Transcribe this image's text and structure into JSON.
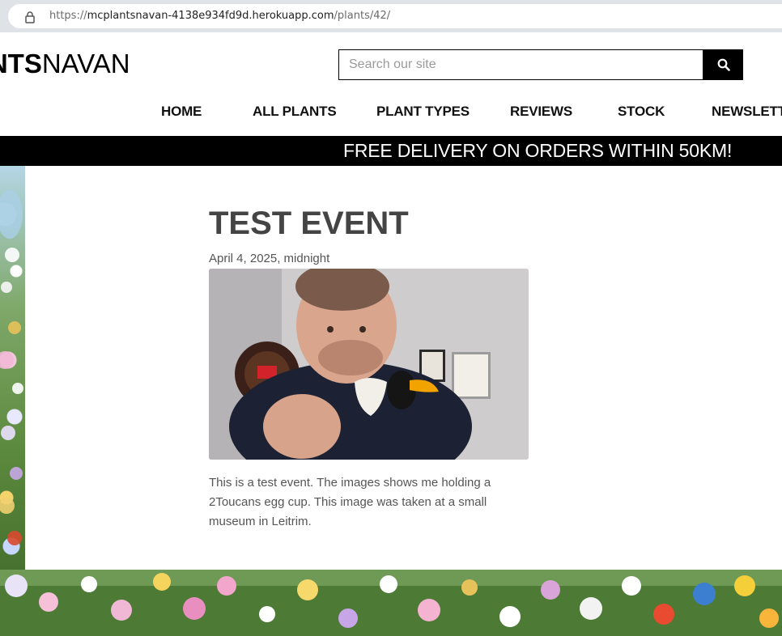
{
  "browser": {
    "lock_icon": "lock-icon",
    "url_scheme": "https://",
    "url_host": "mcplantsnavan-4138e934fd9d.herokuapp.com",
    "url_path": "/plants/42/"
  },
  "header": {
    "logo_bold": "ANTS",
    "logo_rest": "NAVAN",
    "search_placeholder": "Search our site",
    "search_icon": "search-icon"
  },
  "nav": {
    "items": [
      {
        "label": "HOME"
      },
      {
        "label": "ALL PLANTS"
      },
      {
        "label": "PLANT TYPES"
      },
      {
        "label": "REVIEWS"
      },
      {
        "label": "STOCK"
      },
      {
        "label": "NEWSLETTE"
      }
    ]
  },
  "banner": {
    "text": "FREE DELIVERY ON ORDERS WITHIN 50KM!"
  },
  "event": {
    "title": "TEST EVENT",
    "date": "April 4, 2025, midnight",
    "description": "This is a test event. The images shows me holding a 2Toucans egg cup. This image was taken at a small museum in Leitrim."
  },
  "colors": {
    "banner_bg": "#000000",
    "text_dark": "#444444",
    "text_muted": "#555555"
  }
}
